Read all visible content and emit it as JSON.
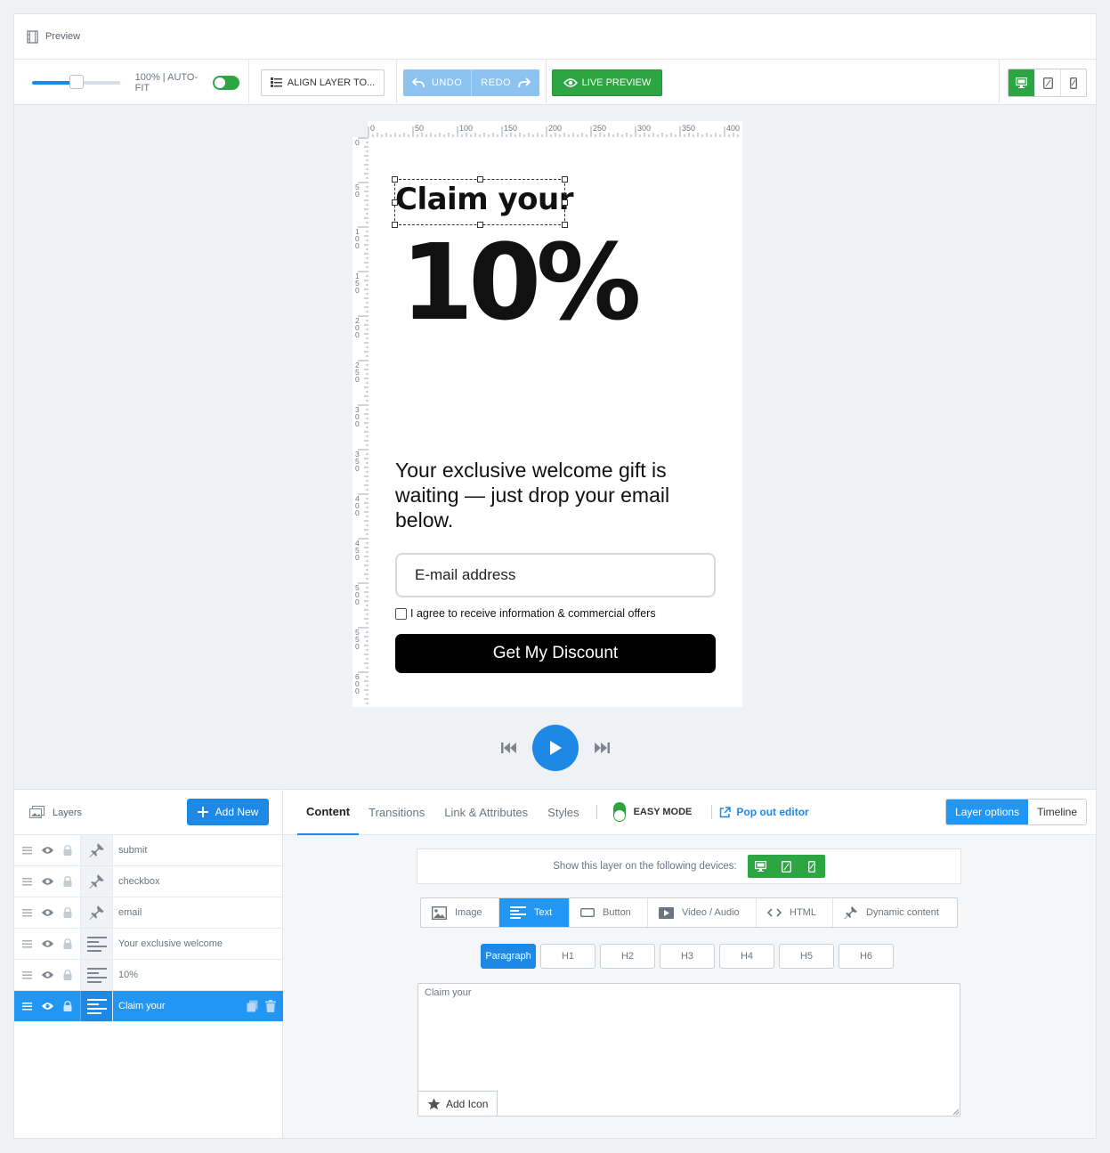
{
  "preview": {
    "label": "Preview"
  },
  "toolbar": {
    "zoom_percent": 50,
    "zoom_label": "100% | AUTO-FIT",
    "autofit_on": true,
    "align_label": "ALIGN LAYER TO...",
    "undo_label": "UNDO",
    "redo_label": "REDO",
    "live_preview_label": "LIVE PREVIEW",
    "active_device": "desktop"
  },
  "ruler": {
    "h_ticks": [
      "0",
      "50",
      "100",
      "150",
      "200",
      "250",
      "300",
      "350",
      "400"
    ],
    "v_ticks": [
      "0",
      "50",
      "100",
      "150",
      "200",
      "250",
      "300",
      "350",
      "400",
      "450",
      "500",
      "550",
      "600"
    ]
  },
  "canvas": {
    "claim_text": "Claim your",
    "discount_text": "10%",
    "description": "Your exclusive welcome gift is waiting — just drop your email below.",
    "email_placeholder": "E-mail address",
    "consent_text": "I agree to receive information & commercial offers",
    "submit_label": "Get My Discount"
  },
  "layers": {
    "title": "Layers",
    "add_new_label": "Add New",
    "items": [
      {
        "name": "submit",
        "type": "pin-icon",
        "active": false
      },
      {
        "name": "checkbox",
        "type": "pin-icon",
        "active": false
      },
      {
        "name": "email",
        "type": "pin-icon",
        "active": false
      },
      {
        "name": "Your exclusive welcome",
        "type": "text-lines-icon",
        "active": false
      },
      {
        "name": "10%",
        "type": "text-lines-icon",
        "active": false
      },
      {
        "name": "Claim your",
        "type": "text-lines-icon",
        "active": true
      }
    ]
  },
  "editor": {
    "tabs": [
      "Content",
      "Transitions",
      "Link & Attributes",
      "Styles"
    ],
    "active_tab": "Content",
    "easy_mode_label": "EASY MODE",
    "popout_label": "Pop out editor",
    "layer_options_label": "Layer options",
    "timeline_label": "Timeline",
    "devices_prompt": "Show this layer on the following devices:",
    "content_types": [
      "Image",
      "Text",
      "Button",
      "Video / Audio",
      "HTML",
      "Dynamic content"
    ],
    "active_content_type": "Text",
    "heading_levels": [
      "Paragraph",
      "H1",
      "H2",
      "H3",
      "H4",
      "H5",
      "H6"
    ],
    "active_heading": "Paragraph",
    "text_value": "Claim your",
    "add_icon_label": "Add Icon"
  },
  "colors": {
    "accent_blue": "#1e88e5",
    "green": "#2ea543",
    "background": "#eef2f5"
  }
}
